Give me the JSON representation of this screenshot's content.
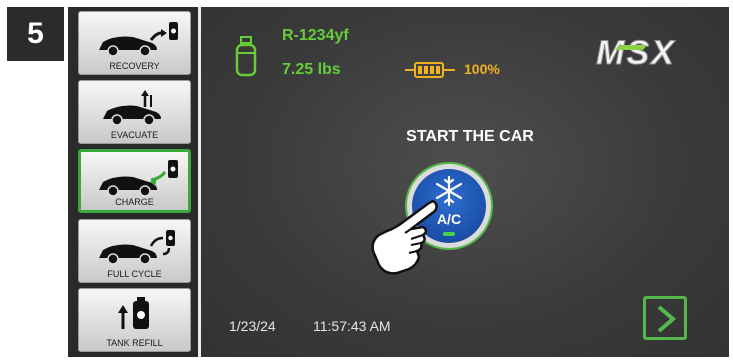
{
  "step_number": "5",
  "sidebar": {
    "items": [
      {
        "label": "RECOVERY",
        "icon": "car-recovery-icon",
        "active": false
      },
      {
        "label": "EVACUATE",
        "icon": "car-evacuate-icon",
        "active": false
      },
      {
        "label": "CHARGE",
        "icon": "car-charge-icon",
        "active": true
      },
      {
        "label": "FULL CYCLE",
        "icon": "car-full-cycle-icon",
        "active": false
      },
      {
        "label": "TANK REFILL",
        "icon": "tank-refill-icon",
        "active": false
      }
    ]
  },
  "status": {
    "refrigerant": "R-1234yf",
    "weight": "7.25 lbs",
    "battery": "100%"
  },
  "logo_text": "MSX",
  "instruction": "START THE CAR",
  "ac_button": {
    "label": "A/C",
    "icon": "snowflake-icon"
  },
  "footer": {
    "date": "1/23/24",
    "time": "11:57:43 AM"
  },
  "colors": {
    "accent_green": "#66cc3a",
    "battery_yellow": "#f0b21e",
    "ac_blue": "#1a4fa8",
    "background": "#3a3a3a"
  }
}
